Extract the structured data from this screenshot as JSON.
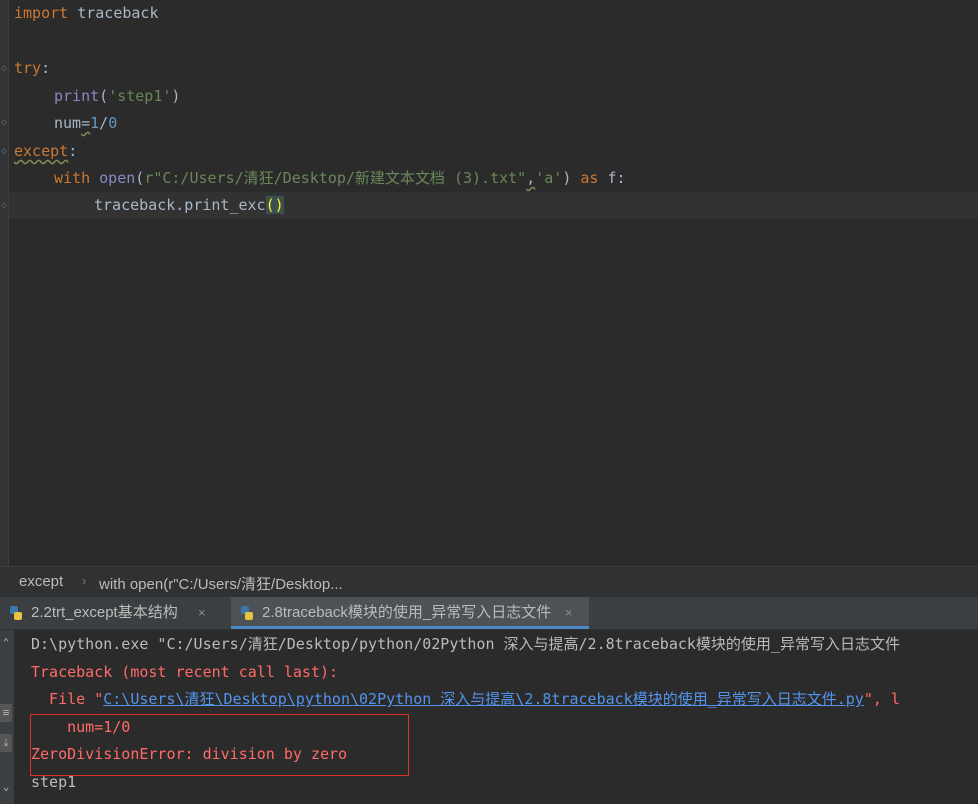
{
  "editor": {
    "lines": {
      "l1": {
        "kw": "import",
        "rest": " traceback"
      },
      "l3": {
        "kw": "try",
        "colon": ":"
      },
      "l4": {
        "fn": "print",
        "open": "(",
        "str": "'step1'",
        "close": ")"
      },
      "l5": {
        "var": "num",
        "eq": "=",
        "n1": "1",
        "slash": "/",
        "n2": "0"
      },
      "l6": {
        "kw": "except",
        "colon": ":"
      },
      "l7": {
        "kw_with": "with",
        "fn": "open",
        "open": "(",
        "str": "r\"C:/Users/清狂/Desktop/新建文本文档 (3).txt\"",
        "comma": ",",
        "str2": "'a'",
        "close": ")",
        "kw_as": "as",
        "var": "f",
        "colon": ":"
      },
      "l8": {
        "call": "traceback.print_exc",
        "parens": "()"
      }
    }
  },
  "breadcrumb": {
    "items": [
      "except",
      "with open(r\"C:/Users/清狂/Desktop..."
    ],
    "separator": "›"
  },
  "run_tabs": [
    {
      "label": "2.2trt_except基本结构",
      "close": "×"
    },
    {
      "label": "2.8traceback模块的使用_异常写入日志文件",
      "close": "×"
    }
  ],
  "console": {
    "command": "D:\\python.exe \"C:/Users/清狂/Desktop/python/02Python 深入与提高/2.8traceback模块的使用_异常写入日志文件",
    "traceback_header": "Traceback (most recent call last):",
    "file_prefix": "  File \"",
    "file_link": "C:\\Users\\清狂\\Desktop\\python\\02Python 深入与提高\\2.8traceback模块的使用_异常写入日志文件.py",
    "file_suffix": "\", l",
    "code_line": "    num=1/0",
    "error_line": "ZeroDivisionError: division by zero",
    "output_line": "step1"
  },
  "colors": {
    "background": "#2b2b2b",
    "keyword": "#cc7832",
    "string": "#6a8759",
    "number": "#6897bb",
    "error": "#ff6b68",
    "link": "#5394ec",
    "highlight_box": "#e0302a"
  }
}
